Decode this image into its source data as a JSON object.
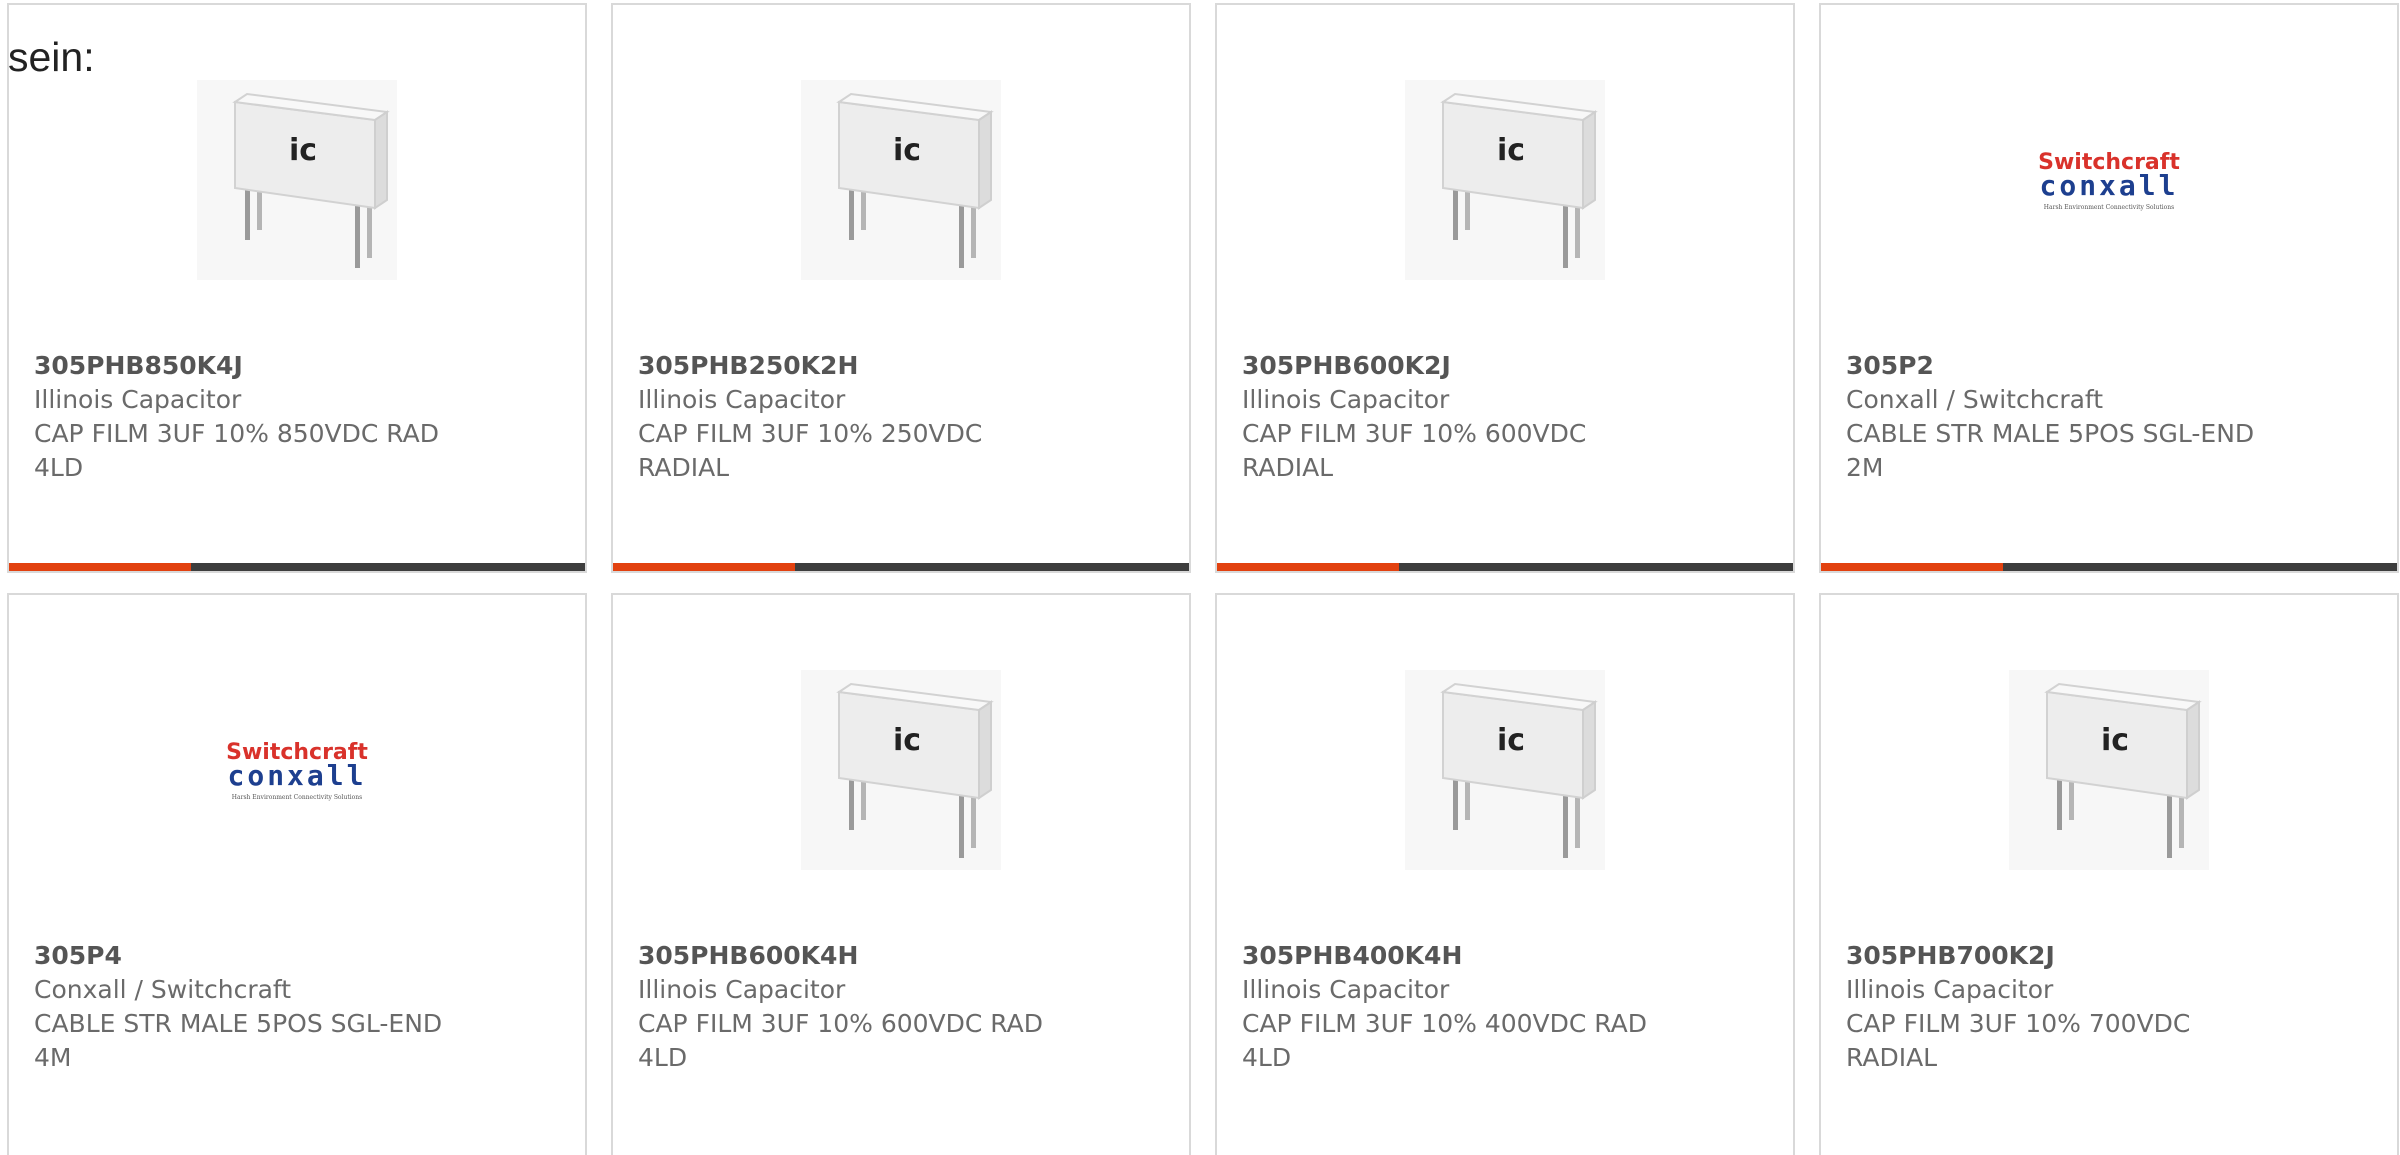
{
  "intro_text": "sein:",
  "accent_color": "#e2410f",
  "bar_color": "#3d3d3d",
  "products": [
    {
      "part": "305PHB850K4J",
      "manufacturer": "Illinois Capacitor",
      "desc_line1": "CAP FILM 3UF 10% 850VDC RAD",
      "desc_line2": "4LD",
      "image": "capacitor"
    },
    {
      "part": "305PHB250K2H",
      "manufacturer": "Illinois Capacitor",
      "desc_line1": "CAP FILM 3UF 10% 250VDC",
      "desc_line2": "RADIAL",
      "image": "capacitor"
    },
    {
      "part": "305PHB600K2J",
      "manufacturer": "Illinois Capacitor",
      "desc_line1": "CAP FILM 3UF 10% 600VDC",
      "desc_line2": "RADIAL",
      "image": "capacitor"
    },
    {
      "part": "305P2",
      "manufacturer": "Conxall / Switchcraft",
      "desc_line1": "CABLE STR MALE 5POS SGL-END",
      "desc_line2": "2M",
      "image": "switchcraft-logo"
    },
    {
      "part": "305P4",
      "manufacturer": "Conxall / Switchcraft",
      "desc_line1": "CABLE STR MALE 5POS SGL-END",
      "desc_line2": "4M",
      "image": "switchcraft-logo"
    },
    {
      "part": "305PHB600K4H",
      "manufacturer": "Illinois Capacitor",
      "desc_line1": "CAP FILM 3UF 10% 600VDC RAD",
      "desc_line2": "4LD",
      "image": "capacitor"
    },
    {
      "part": "305PHB400K4H",
      "manufacturer": "Illinois Capacitor",
      "desc_line1": "CAP FILM 3UF 10% 400VDC RAD",
      "desc_line2": "4LD",
      "image": "capacitor"
    },
    {
      "part": "305PHB700K2J",
      "manufacturer": "Illinois Capacitor",
      "desc_line1": "CAP FILM 3UF 10% 700VDC",
      "desc_line2": "RADIAL",
      "image": "capacitor"
    }
  ],
  "logo": {
    "line1": "Switchcraft",
    "line2": "conxall",
    "tagline": "Harsh Environment Connectivity Solutions"
  }
}
